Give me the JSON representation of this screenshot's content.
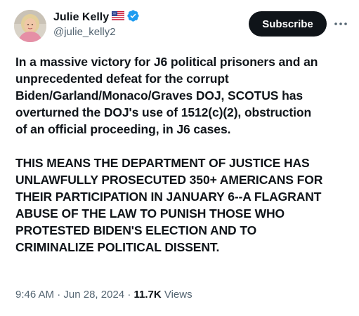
{
  "author": {
    "display_name": "Julie Kelly",
    "handle": "@julie_kelly2",
    "flag_icon": "us-flag-icon",
    "verified_icon": "verified-badge-icon",
    "verified_color": "#1d9bf0"
  },
  "actions": {
    "subscribe_label": "Subscribe",
    "more_icon": "more-horizontal-icon"
  },
  "tweet": {
    "paragraph_1": "In a massive victory for J6 political prisoners and an\nunprecedented defeat for the corrupt\nBiden/Garland/Monaco/Graves DOJ, SCOTUS has\noverturned the DOJ's use of 1512(c)(2), obstruction\nof an official proceeding, in J6 cases.",
    "paragraph_2": "THIS MEANS THE DEPARTMENT OF JUSTICE HAS\nUNLAWFULLY PROSECUTED 350+ AMERICANS FOR\nTHEIR PARTICIPATION IN JANUARY 6--A FLAGRANT\nABUSE OF THE LAW TO PUNISH THOSE WHO\nPROTESTED BIDEN'S ELECTION AND TO\nCRIMINALIZE POLITICAL DISSENT."
  },
  "meta": {
    "time": "9:46 AM",
    "separator": "·",
    "date": "Jun 28, 2024",
    "views_count": "11.7K",
    "views_label": "Views"
  },
  "colors": {
    "text_primary": "#0f1419",
    "text_secondary": "#536471",
    "button_bg": "#0f1419",
    "button_text": "#ffffff"
  }
}
